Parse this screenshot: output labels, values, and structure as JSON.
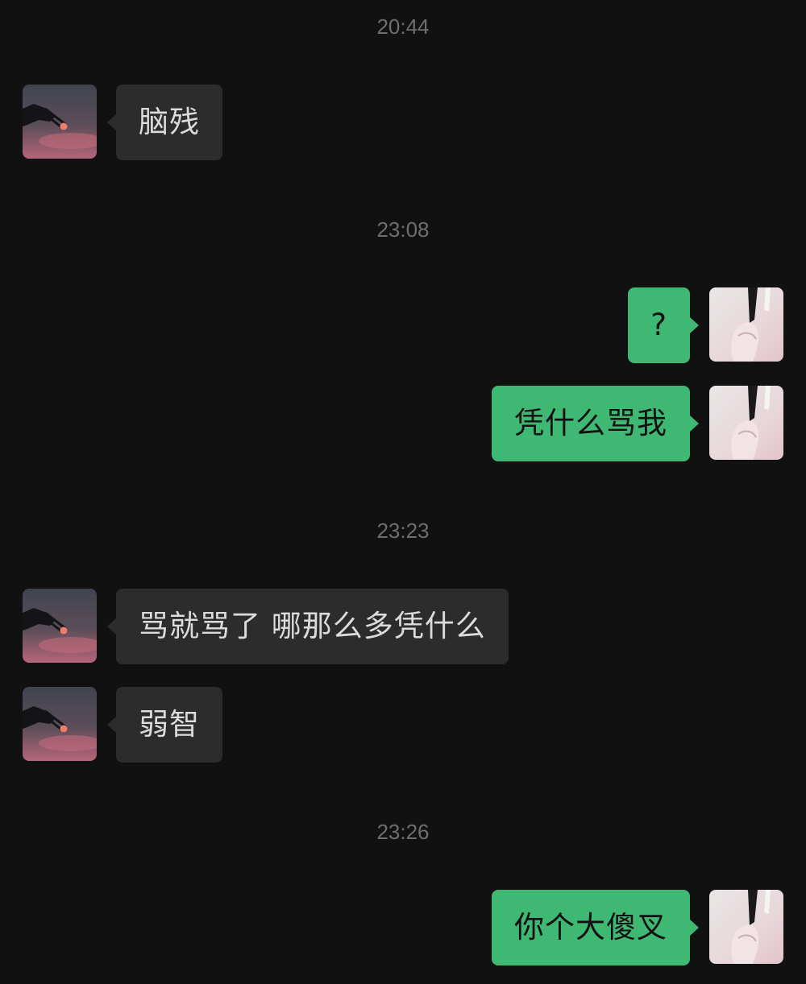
{
  "colors": {
    "background": "#111111",
    "timestamp": "#6e6e6e",
    "incoming_bubble": "#2c2c2c",
    "incoming_text": "#dcdcdc",
    "outgoing_bubble": "#3eb873",
    "outgoing_text": "#111111"
  },
  "contact": {
    "avatar_icon": "sunset-hand-avatar"
  },
  "self": {
    "avatar_icon": "pink-cloth-avatar"
  },
  "timestamps": [
    "20:44",
    "23:08",
    "23:23",
    "23:26"
  ],
  "messages": [
    {
      "from": "contact",
      "text": "脑残"
    },
    {
      "from": "self",
      "text": "?"
    },
    {
      "from": "self",
      "text": "凭什么骂我"
    },
    {
      "from": "contact",
      "text": "骂就骂了 哪那么多凭什么"
    },
    {
      "from": "contact",
      "text": "弱智"
    },
    {
      "from": "self",
      "text": "你个大傻叉"
    }
  ]
}
